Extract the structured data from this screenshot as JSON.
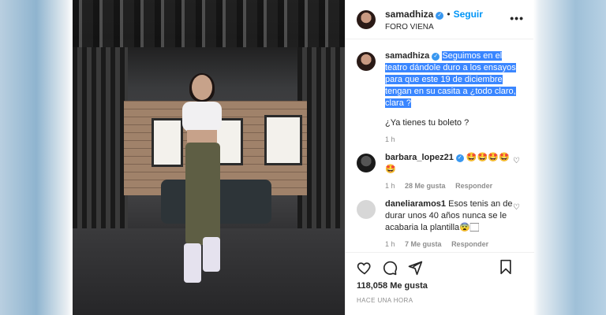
{
  "post": {
    "author": "samadhiza",
    "follow_label": "Seguir",
    "dot": "•",
    "location": "FORO VIENA",
    "more": "•••",
    "caption": {
      "author": "samadhiza",
      "highlighted_text": "Seguimos en el teatro dándole duro a los ensayos para que este 19 de diciembre tengan en su casita a ¿todo claro, clara ?",
      "second_line": "¿Ya tienes tu boleto ?",
      "time": "1 h"
    },
    "comments": [
      {
        "author": "barbara_lopez21",
        "text": "🤩🤩🤩🤩🤩",
        "time": "1 h",
        "likes": "28 Me gusta",
        "reply": "Responder"
      },
      {
        "author": "daneliaramos1",
        "text": "Esos tenis an de durar unos 40 años nunca se le acabaria la plantilla😨🏻",
        "time": "1 h",
        "likes": "7 Me gusta",
        "reply": "Responder"
      }
    ],
    "likes_count": "118,058 Me gusta",
    "time_ago": "HACE UNA HORA"
  },
  "icons": [
    "heart-icon",
    "comment-icon",
    "share-icon",
    "bookmark-icon",
    "verified-icon"
  ],
  "colors": {
    "accent": "#0095f6",
    "verified": "#3897f0",
    "highlight": "#3a86ff"
  }
}
